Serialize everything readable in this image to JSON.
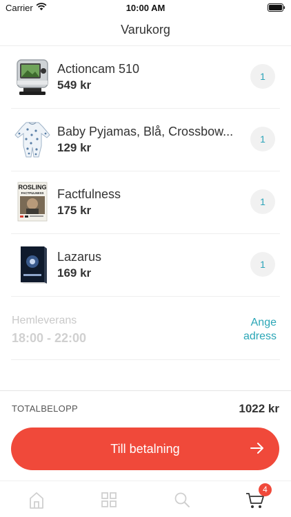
{
  "status_bar": {
    "carrier": "Carrier",
    "time": "10:00 AM"
  },
  "nav": {
    "title": "Varukorg"
  },
  "cart_items": [
    {
      "name": "Actioncam 510",
      "price": "549 kr",
      "quantity": "1",
      "icon": "action-camera"
    },
    {
      "name": "Baby Pyjamas, Blå, Crossbow...",
      "price": "129 kr",
      "quantity": "1",
      "icon": "baby-pyjamas"
    },
    {
      "name": "Factfulness",
      "price": "175 kr",
      "quantity": "1",
      "icon": "book-factfulness",
      "cover_text": [
        "ROSLING",
        "FACTFULNESS"
      ]
    },
    {
      "name": "Lazarus",
      "price": "169 kr",
      "quantity": "1",
      "icon": "book-lazarus"
    }
  ],
  "delivery": {
    "type": "Hemleverans",
    "time": "18:00 - 22:00",
    "change_label_line1": "Ange",
    "change_label_line2": "adress"
  },
  "summary": {
    "total_label": "TOTALBELOPP",
    "total_value": "1022 kr"
  },
  "checkout": {
    "label": "Till betalning"
  },
  "tabbar": {
    "items": [
      "home-icon",
      "grid-icon",
      "search-icon",
      "cart-icon"
    ],
    "cart_badge": "4"
  },
  "colors": {
    "accent": "#f0493a",
    "link": "#2aa6b6",
    "inactive_tab": "#cfcfcf"
  }
}
